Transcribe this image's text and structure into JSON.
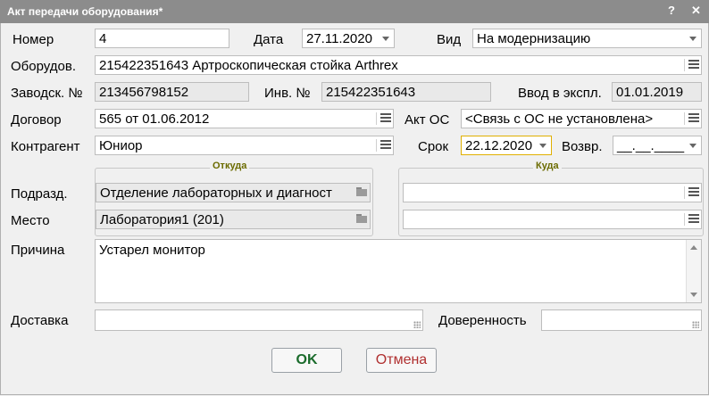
{
  "window": {
    "title": "Акт передачи оборудования*",
    "help_label": "?",
    "close_label": "✕"
  },
  "form": {
    "number": {
      "label": "Номер",
      "value": "4"
    },
    "date": {
      "label": "Дата",
      "value": "27.11.2020"
    },
    "type": {
      "label": "Вид",
      "value": "На модернизацию"
    },
    "equipment": {
      "label": "Оборудов.",
      "value": "215422351643 Артроскопическая стойка Arthrex"
    },
    "serial": {
      "label": "Заводск. №",
      "value": "213456798152"
    },
    "inventory": {
      "label": "Инв. №",
      "value": "215422351643"
    },
    "commission": {
      "label": "Ввод в экспл.",
      "value": "01.01.2019"
    },
    "contract": {
      "label": "Договор",
      "value": "565 от 01.06.2012"
    },
    "act_os": {
      "label": "Акт ОС",
      "value": "<Связь с ОС не установлена>"
    },
    "contractor": {
      "label": "Контрагент",
      "value": "Юниор"
    },
    "term": {
      "label": "Срок",
      "value": "22.12.2020"
    },
    "return": {
      "label": "Возвр.",
      "value": "__.__.____"
    },
    "from_group": "Откуда",
    "to_group": "Куда",
    "department": {
      "label": "Подразд.",
      "from_value": "Отделение лабораторных и диагност",
      "to_value": ""
    },
    "place": {
      "label": "Место",
      "from_value": "Лаборатория1 (201)",
      "to_value": ""
    },
    "reason": {
      "label": "Причина",
      "value": "Устарел монитор"
    },
    "delivery": {
      "label": "Доставка",
      "value": ""
    },
    "power_of_attorney": {
      "label": "Доверенность",
      "value": ""
    }
  },
  "buttons": {
    "ok": "OK",
    "cancel": "Отмена"
  },
  "colors": {
    "titlebar": "#8c8c8c",
    "ok_text": "#1a6b2b",
    "cancel_text": "#b03030",
    "group_title": "#6b6b00",
    "focus_border": "#e0b000"
  }
}
